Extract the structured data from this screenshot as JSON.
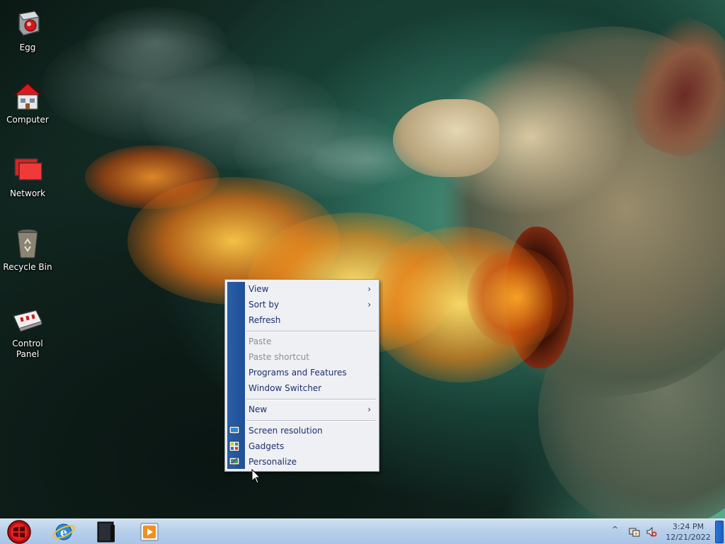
{
  "desktop": {
    "icons": [
      {
        "label": "Egg"
      },
      {
        "label": "Computer"
      },
      {
        "label": "Network"
      },
      {
        "label": "Recycle Bin"
      },
      {
        "label": "Control Panel"
      }
    ]
  },
  "context_menu": {
    "items": [
      {
        "label": "View",
        "has_submenu": true,
        "enabled": true
      },
      {
        "label": "Sort by",
        "has_submenu": true,
        "enabled": true
      },
      {
        "label": "Refresh",
        "enabled": true
      },
      {
        "label": "Paste",
        "enabled": false
      },
      {
        "label": "Paste shortcut",
        "enabled": false
      },
      {
        "label": "Programs and Features",
        "enabled": true
      },
      {
        "label": "Window Switcher",
        "enabled": true
      },
      {
        "label": "New",
        "has_submenu": true,
        "enabled": true
      },
      {
        "label": "Screen resolution",
        "icon": "monitor-icon",
        "enabled": true
      },
      {
        "label": "Gadgets",
        "icon": "gadgets-icon",
        "enabled": true
      },
      {
        "label": "Personalize",
        "icon": "personalize-icon",
        "enabled": true
      }
    ],
    "submenu_glyph": "›"
  },
  "taskbar": {
    "pinned": [
      {
        "icon": "internet-explorer-icon"
      },
      {
        "icon": "terminal-icon"
      },
      {
        "icon": "media-player-icon"
      }
    ],
    "tray": {
      "chevron": "^",
      "icons": [
        "network-tray-icon",
        "volume-muted-icon"
      ]
    },
    "clock": {
      "time": "3:24 PM",
      "date": "12/21/2022"
    }
  },
  "colors": {
    "menu_strip": "#1f4f97",
    "menu_text": "#1e2f6e",
    "menu_disabled_text": "#8c8f98",
    "taskbar_top": "#cfe0f1",
    "taskbar_bottom": "#a9c5e6",
    "start_button": "#c81414"
  }
}
